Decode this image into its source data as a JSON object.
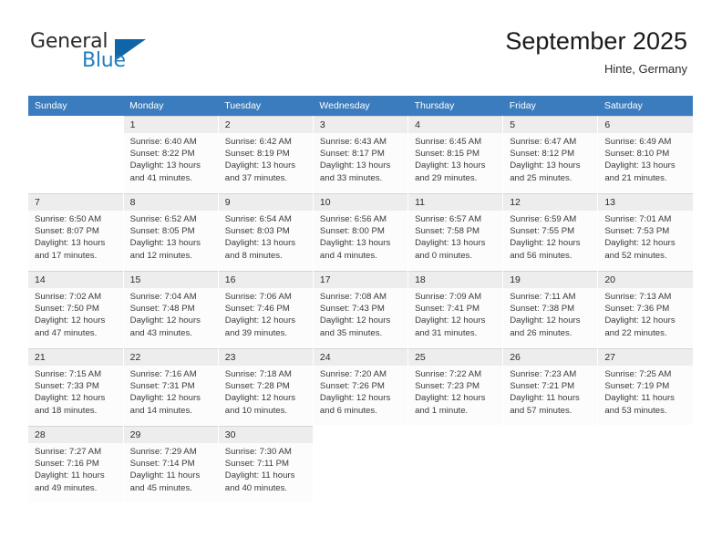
{
  "brand": {
    "name_part1": "General",
    "name_part2": "Blue",
    "logo_icon": "blue-triangle-logo"
  },
  "header": {
    "title": "September 2025",
    "location": "Hinte, Germany"
  },
  "colors": {
    "header_row_bg": "#3a7cbe",
    "daynum_bg": "#ededed",
    "brand_blue": "#1f7ec2",
    "logo_blue": "#1064a8",
    "cell_bg": "#fcfcfc",
    "grid_line": "#d4d4d4"
  },
  "weekday_headers": [
    "Sunday",
    "Monday",
    "Tuesday",
    "Wednesday",
    "Thursday",
    "Friday",
    "Saturday"
  ],
  "weeks": [
    [
      {
        "empty": true
      },
      {
        "day": "1",
        "sunrise": "Sunrise: 6:40 AM",
        "sunset": "Sunset: 8:22 PM",
        "daylight_line1": "Daylight: 13 hours",
        "daylight_line2": "and 41 minutes."
      },
      {
        "day": "2",
        "sunrise": "Sunrise: 6:42 AM",
        "sunset": "Sunset: 8:19 PM",
        "daylight_line1": "Daylight: 13 hours",
        "daylight_line2": "and 37 minutes."
      },
      {
        "day": "3",
        "sunrise": "Sunrise: 6:43 AM",
        "sunset": "Sunset: 8:17 PM",
        "daylight_line1": "Daylight: 13 hours",
        "daylight_line2": "and 33 minutes."
      },
      {
        "day": "4",
        "sunrise": "Sunrise: 6:45 AM",
        "sunset": "Sunset: 8:15 PM",
        "daylight_line1": "Daylight: 13 hours",
        "daylight_line2": "and 29 minutes."
      },
      {
        "day": "5",
        "sunrise": "Sunrise: 6:47 AM",
        "sunset": "Sunset: 8:12 PM",
        "daylight_line1": "Daylight: 13 hours",
        "daylight_line2": "and 25 minutes."
      },
      {
        "day": "6",
        "sunrise": "Sunrise: 6:49 AM",
        "sunset": "Sunset: 8:10 PM",
        "daylight_line1": "Daylight: 13 hours",
        "daylight_line2": "and 21 minutes."
      }
    ],
    [
      {
        "day": "7",
        "sunrise": "Sunrise: 6:50 AM",
        "sunset": "Sunset: 8:07 PM",
        "daylight_line1": "Daylight: 13 hours",
        "daylight_line2": "and 17 minutes."
      },
      {
        "day": "8",
        "sunrise": "Sunrise: 6:52 AM",
        "sunset": "Sunset: 8:05 PM",
        "daylight_line1": "Daylight: 13 hours",
        "daylight_line2": "and 12 minutes."
      },
      {
        "day": "9",
        "sunrise": "Sunrise: 6:54 AM",
        "sunset": "Sunset: 8:03 PM",
        "daylight_line1": "Daylight: 13 hours",
        "daylight_line2": "and 8 minutes."
      },
      {
        "day": "10",
        "sunrise": "Sunrise: 6:56 AM",
        "sunset": "Sunset: 8:00 PM",
        "daylight_line1": "Daylight: 13 hours",
        "daylight_line2": "and 4 minutes."
      },
      {
        "day": "11",
        "sunrise": "Sunrise: 6:57 AM",
        "sunset": "Sunset: 7:58 PM",
        "daylight_line1": "Daylight: 13 hours",
        "daylight_line2": "and 0 minutes."
      },
      {
        "day": "12",
        "sunrise": "Sunrise: 6:59 AM",
        "sunset": "Sunset: 7:55 PM",
        "daylight_line1": "Daylight: 12 hours",
        "daylight_line2": "and 56 minutes."
      },
      {
        "day": "13",
        "sunrise": "Sunrise: 7:01 AM",
        "sunset": "Sunset: 7:53 PM",
        "daylight_line1": "Daylight: 12 hours",
        "daylight_line2": "and 52 minutes."
      }
    ],
    [
      {
        "day": "14",
        "sunrise": "Sunrise: 7:02 AM",
        "sunset": "Sunset: 7:50 PM",
        "daylight_line1": "Daylight: 12 hours",
        "daylight_line2": "and 47 minutes."
      },
      {
        "day": "15",
        "sunrise": "Sunrise: 7:04 AM",
        "sunset": "Sunset: 7:48 PM",
        "daylight_line1": "Daylight: 12 hours",
        "daylight_line2": "and 43 minutes."
      },
      {
        "day": "16",
        "sunrise": "Sunrise: 7:06 AM",
        "sunset": "Sunset: 7:46 PM",
        "daylight_line1": "Daylight: 12 hours",
        "daylight_line2": "and 39 minutes."
      },
      {
        "day": "17",
        "sunrise": "Sunrise: 7:08 AM",
        "sunset": "Sunset: 7:43 PM",
        "daylight_line1": "Daylight: 12 hours",
        "daylight_line2": "and 35 minutes."
      },
      {
        "day": "18",
        "sunrise": "Sunrise: 7:09 AM",
        "sunset": "Sunset: 7:41 PM",
        "daylight_line1": "Daylight: 12 hours",
        "daylight_line2": "and 31 minutes."
      },
      {
        "day": "19",
        "sunrise": "Sunrise: 7:11 AM",
        "sunset": "Sunset: 7:38 PM",
        "daylight_line1": "Daylight: 12 hours",
        "daylight_line2": "and 26 minutes."
      },
      {
        "day": "20",
        "sunrise": "Sunrise: 7:13 AM",
        "sunset": "Sunset: 7:36 PM",
        "daylight_line1": "Daylight: 12 hours",
        "daylight_line2": "and 22 minutes."
      }
    ],
    [
      {
        "day": "21",
        "sunrise": "Sunrise: 7:15 AM",
        "sunset": "Sunset: 7:33 PM",
        "daylight_line1": "Daylight: 12 hours",
        "daylight_line2": "and 18 minutes."
      },
      {
        "day": "22",
        "sunrise": "Sunrise: 7:16 AM",
        "sunset": "Sunset: 7:31 PM",
        "daylight_line1": "Daylight: 12 hours",
        "daylight_line2": "and 14 minutes."
      },
      {
        "day": "23",
        "sunrise": "Sunrise: 7:18 AM",
        "sunset": "Sunset: 7:28 PM",
        "daylight_line1": "Daylight: 12 hours",
        "daylight_line2": "and 10 minutes."
      },
      {
        "day": "24",
        "sunrise": "Sunrise: 7:20 AM",
        "sunset": "Sunset: 7:26 PM",
        "daylight_line1": "Daylight: 12 hours",
        "daylight_line2": "and 6 minutes."
      },
      {
        "day": "25",
        "sunrise": "Sunrise: 7:22 AM",
        "sunset": "Sunset: 7:23 PM",
        "daylight_line1": "Daylight: 12 hours",
        "daylight_line2": "and 1 minute."
      },
      {
        "day": "26",
        "sunrise": "Sunrise: 7:23 AM",
        "sunset": "Sunset: 7:21 PM",
        "daylight_line1": "Daylight: 11 hours",
        "daylight_line2": "and 57 minutes."
      },
      {
        "day": "27",
        "sunrise": "Sunrise: 7:25 AM",
        "sunset": "Sunset: 7:19 PM",
        "daylight_line1": "Daylight: 11 hours",
        "daylight_line2": "and 53 minutes."
      }
    ],
    [
      {
        "day": "28",
        "sunrise": "Sunrise: 7:27 AM",
        "sunset": "Sunset: 7:16 PM",
        "daylight_line1": "Daylight: 11 hours",
        "daylight_line2": "and 49 minutes."
      },
      {
        "day": "29",
        "sunrise": "Sunrise: 7:29 AM",
        "sunset": "Sunset: 7:14 PM",
        "daylight_line1": "Daylight: 11 hours",
        "daylight_line2": "and 45 minutes."
      },
      {
        "day": "30",
        "sunrise": "Sunrise: 7:30 AM",
        "sunset": "Sunset: 7:11 PM",
        "daylight_line1": "Daylight: 11 hours",
        "daylight_line2": "and 40 minutes."
      },
      {
        "empty": true
      },
      {
        "empty": true
      },
      {
        "empty": true
      },
      {
        "empty": true
      }
    ]
  ]
}
